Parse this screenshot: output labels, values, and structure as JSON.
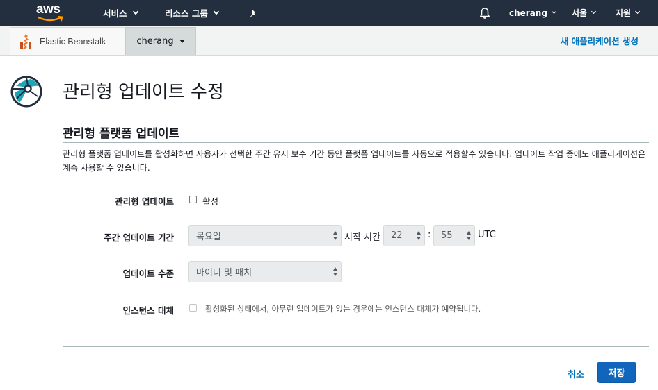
{
  "topnav": {
    "logo_text": "aws",
    "services": "서비스",
    "resource_groups": "리소스 그룹",
    "user": "cherang",
    "region": "서울",
    "support": "지원"
  },
  "subbar": {
    "service_name": "Elastic Beanstalk",
    "environment": "cherang",
    "new_app": "새 애플리케이션 생성"
  },
  "page": {
    "title": "관리형 업데이트 수정",
    "section_title": "관리형 플랫폼 업데이트",
    "description": "관리형 플랫폼 업데이트를 활성화하면 사용자가 선택한 주간 유지 보수 기간 동안 플랫폼 업데이트를 자동으로 적용할수 있습니다. 업데이트 작업 중에도 애플리케이션은 계속 사용할 수 있습니다."
  },
  "form": {
    "managed_label": "관리형 업데이트",
    "managed_checkbox_label": "활성",
    "window_label": "주간 업데이트 기간",
    "day_value": "목요일",
    "start_time_label": "시작 시간",
    "hour_value": "22",
    "colon": ":",
    "minute_value": "55",
    "utc": "UTC",
    "level_label": "업데이트 수준",
    "level_value": "마이너 및 패치",
    "replace_label": "인스턴스 대체",
    "replace_checkbox_label": "활성화된 상태에서, 아무런 업데이트가 없는 경우에는 인스턴스 대체가 예약됩니다."
  },
  "footer": {
    "cancel": "취소",
    "save": "저장"
  },
  "colors": {
    "nav_bg": "#232f3e",
    "link": "#0073bb",
    "primary": "#1166bb"
  }
}
